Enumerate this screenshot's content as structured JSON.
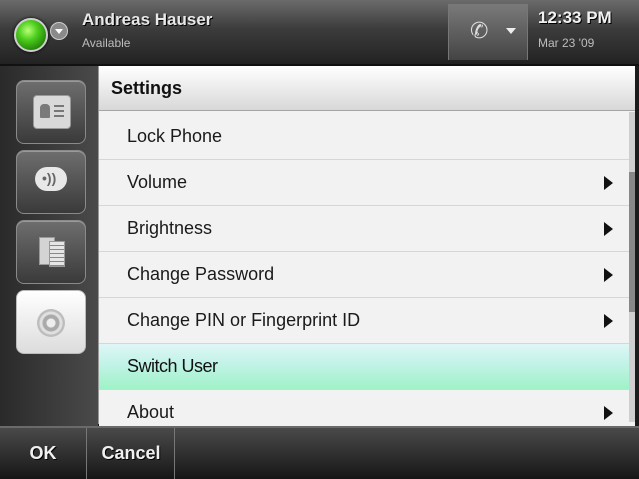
{
  "status_bar": {
    "user_name": "Andreas Hauser",
    "user_status": "Available",
    "time": "12:33 PM",
    "date": "Mar 23 '09"
  },
  "rail": {
    "items": [
      {
        "name": "contacts-icon",
        "active": false
      },
      {
        "name": "speech-bubble-icon",
        "active": false
      },
      {
        "name": "documents-icon",
        "active": false
      },
      {
        "name": "settings-gear-icon",
        "active": true
      }
    ]
  },
  "panel": {
    "title": "Settings",
    "items": [
      {
        "label": "Lock Phone",
        "has_submenu": false
      },
      {
        "label": "Volume",
        "has_submenu": true
      },
      {
        "label": "Brightness",
        "has_submenu": true
      },
      {
        "label": "Change Password",
        "has_submenu": true
      },
      {
        "label": "Change PIN or Fingerprint ID",
        "has_submenu": true
      },
      {
        "label": "Switch User",
        "has_submenu": false,
        "selected": true
      },
      {
        "label": "About",
        "has_submenu": true
      }
    ]
  },
  "softkeys": {
    "ok": "OK",
    "cancel": "Cancel"
  },
  "colors": {
    "selected_row": "#9ff2c7",
    "presence_available": "#4fcf1e"
  }
}
